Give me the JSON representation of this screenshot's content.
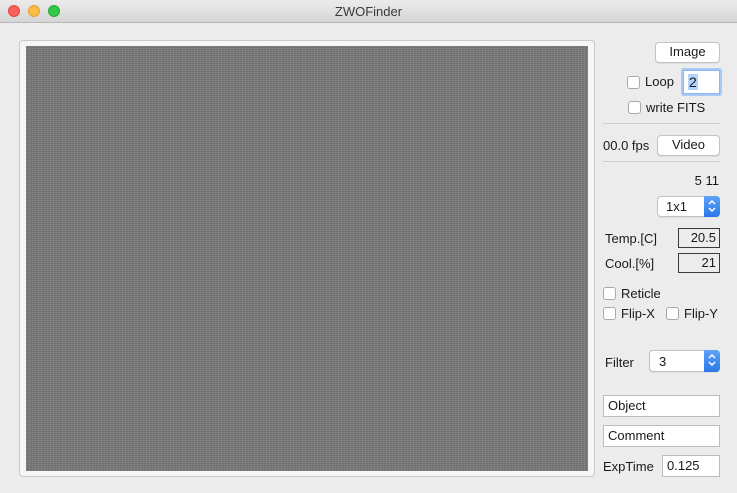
{
  "window": {
    "title": "ZWOFinder"
  },
  "controls": {
    "image_button": "Image",
    "loop_label": "Loop",
    "loop_value": "2",
    "write_fits_label": "write FITS",
    "fps_text": "00.0 fps",
    "video_button": "Video",
    "status_numbers": "5 11",
    "binning_value": "1x1",
    "temp_label": "Temp.[C]",
    "temp_value": "20.5",
    "cool_label": "Cool.[%]",
    "cool_value": "21",
    "reticle_label": "Reticle",
    "flip_x_label": "Flip-X",
    "flip_y_label": "Flip-Y",
    "filter_label": "Filter",
    "filter_value": "3",
    "object_value": "Object",
    "comment_value": "Comment",
    "exptime_label": "ExpTime",
    "exptime_value": "0.125"
  },
  "checkboxes": {
    "loop": false,
    "write_fits": false,
    "reticle": false,
    "flip_x": false,
    "flip_y": false
  },
  "colors": {
    "accent": "#2a78e8",
    "image_gray": "#7b7b7b",
    "window_bg": "#ececec"
  }
}
